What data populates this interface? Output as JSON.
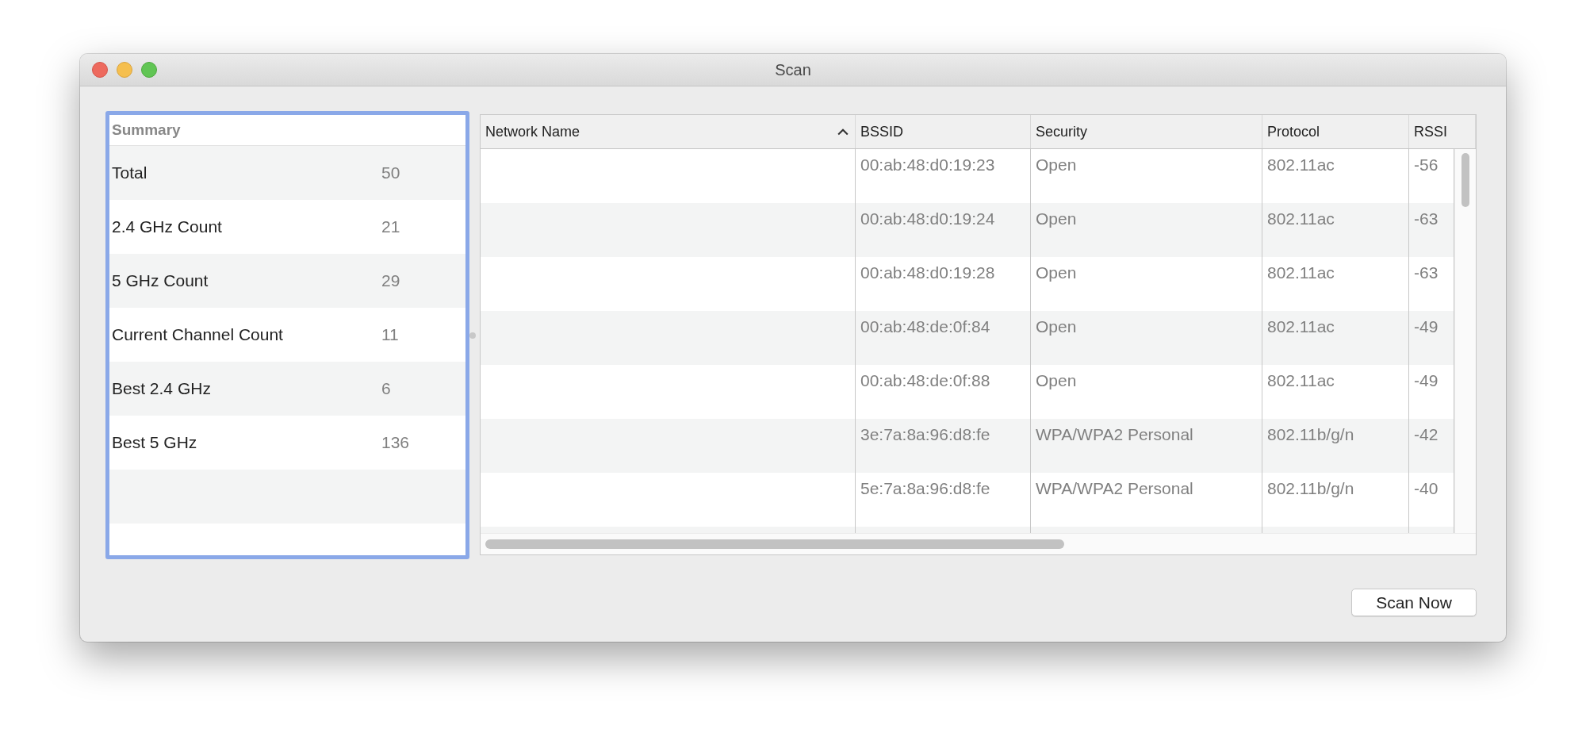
{
  "window": {
    "title": "Scan"
  },
  "summary": {
    "title": "Summary",
    "focused": true,
    "rows": [
      {
        "label": "Total",
        "value": "50"
      },
      {
        "label": "2.4 GHz Count",
        "value": "21"
      },
      {
        "label": "5 GHz Count",
        "value": "29"
      },
      {
        "label": "Current Channel Count",
        "value": "11"
      },
      {
        "label": "Best 2.4 GHz",
        "value": "6"
      },
      {
        "label": "Best 5 GHz",
        "value": "136"
      }
    ]
  },
  "table": {
    "columns": [
      {
        "label": "Network Name",
        "sorted": true
      },
      {
        "label": "BSSID",
        "sorted": false
      },
      {
        "label": "Security",
        "sorted": false
      },
      {
        "label": "Protocol",
        "sorted": false
      },
      {
        "label": "RSSI",
        "sorted": false
      }
    ],
    "rows": [
      {
        "bssid": "00:ab:48:d0:19:23",
        "security": "Open",
        "protocol": "802.11ac",
        "rssi": "-56"
      },
      {
        "bssid": "00:ab:48:d0:19:24",
        "security": "Open",
        "protocol": "802.11ac",
        "rssi": "-63"
      },
      {
        "bssid": "00:ab:48:d0:19:28",
        "security": "Open",
        "protocol": "802.11ac",
        "rssi": "-63"
      },
      {
        "bssid": "00:ab:48:de:0f:84",
        "security": "Open",
        "protocol": "802.11ac",
        "rssi": "-49"
      },
      {
        "bssid": "00:ab:48:de:0f:88",
        "security": "Open",
        "protocol": "802.11ac",
        "rssi": "-49"
      },
      {
        "bssid": "3e:7a:8a:96:d8:fe",
        "security": "WPA/WPA2 Personal",
        "protocol": "802.11b/g/n",
        "rssi": "-42"
      },
      {
        "bssid": "5e:7a:8a:96:d8:fe",
        "security": "WPA/WPA2 Personal",
        "protocol": "802.11b/g/n",
        "rssi": "-40"
      }
    ]
  },
  "buttons": [
    {
      "label": "Scan Now"
    }
  ]
}
